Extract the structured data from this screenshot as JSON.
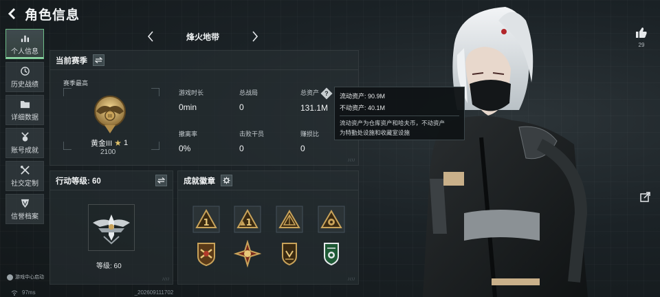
{
  "header": {
    "title": "角色信息"
  },
  "sidebar": {
    "items": [
      {
        "label": "个人信息",
        "active": true,
        "icon": "bar-chart-icon"
      },
      {
        "label": "历史战绩",
        "active": false,
        "icon": "history-icon"
      },
      {
        "label": "详细数据",
        "active": false,
        "icon": "folder-icon"
      },
      {
        "label": "账号成就",
        "active": false,
        "icon": "medal-icon"
      },
      {
        "label": "社交定制",
        "active": false,
        "icon": "tools-icon"
      },
      {
        "label": "信誉档案",
        "active": false,
        "icon": "shield-icon"
      }
    ],
    "game_center": "游戏中心启动"
  },
  "status_bar": {
    "ping": "97ms",
    "uid": "_202609111702"
  },
  "map_selector": {
    "name": "烽火地带"
  },
  "season": {
    "title": "当前赛季",
    "best_label": "赛季最高",
    "rank_name": "黄金III",
    "rank_stars": "1",
    "rank_score": "2100",
    "stats": [
      {
        "label": "游戏时长",
        "value": "0min"
      },
      {
        "label": "总战局",
        "value": "0"
      },
      {
        "label": "总资产",
        "value": "131.1M",
        "has_help": true
      },
      {
        "label": "撤离率",
        "value": "0%"
      },
      {
        "label": "击败干员",
        "value": "0"
      },
      {
        "label": "赚损比",
        "value": "0"
      }
    ]
  },
  "tooltip": {
    "liquid": "流动资产: 90.9M",
    "fixed": "不动资产: 40.1M",
    "desc_1": "流动资产为仓库资产和哈夫币，不动资产",
    "desc_2": "为特勤处设施和收藏室设施"
  },
  "level_panel": {
    "title": "行动等级: 60",
    "level_label": "等级: 60"
  },
  "achievements": {
    "title": "成就徽章",
    "badges": [
      "rank-one-badge",
      "rank-one-plus-badge",
      "pyramid-badge",
      "tri-star-badge",
      "crest-badge",
      "cross-star-badge",
      "shield-badge",
      "green-shield-badge"
    ]
  },
  "social": {
    "likes": "29"
  },
  "colors": {
    "accent_green": "#8fd6a4",
    "gold": "#c9a35a",
    "panel": "#262e32"
  }
}
